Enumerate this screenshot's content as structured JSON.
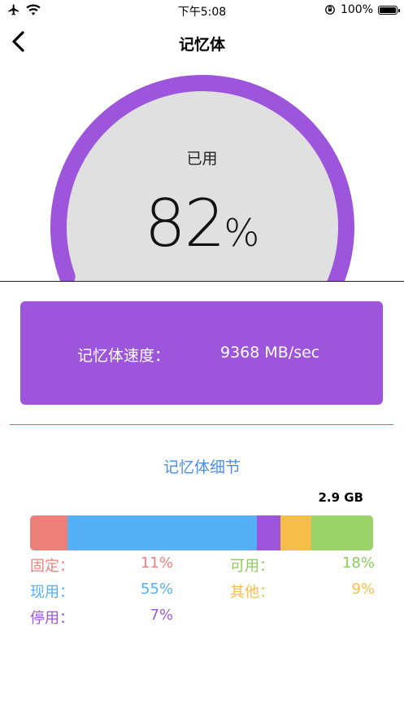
{
  "status": {
    "time": "下午5:08",
    "battery": "100%"
  },
  "nav": {
    "title": "记忆体"
  },
  "gauge": {
    "label": "已用",
    "value": "82",
    "unit": "%",
    "used_fraction": 0.82
  },
  "speed": {
    "label": "记忆体速度：",
    "value": "9368 MB/sec"
  },
  "details": {
    "title": "记忆体细节",
    "total": "2.9 GB",
    "segments": [
      {
        "name": "固定",
        "label": "固定：",
        "percent": "11%",
        "fraction": 0.11,
        "color": "#ee807c"
      },
      {
        "name": "现用",
        "label": "现用：",
        "percent": "55%",
        "fraction": 0.55,
        "color": "#55b0f6"
      },
      {
        "name": "停用",
        "label": "停用：",
        "percent": "7%",
        "fraction": 0.07,
        "color": "#9d55dc"
      },
      {
        "name": "其他",
        "label": "其他：",
        "percent": "9%",
        "fraction": 0.09,
        "color": "#f5bd4a"
      },
      {
        "name": "可用",
        "label": "可用：",
        "percent": "18%",
        "fraction": 0.18,
        "color": "#9ad36a"
      }
    ]
  },
  "colors": {
    "accent": "#9d55dc",
    "track": "#a8a8a8",
    "gauge_fill": "#e0e0e0",
    "link": "#4a90e2"
  }
}
